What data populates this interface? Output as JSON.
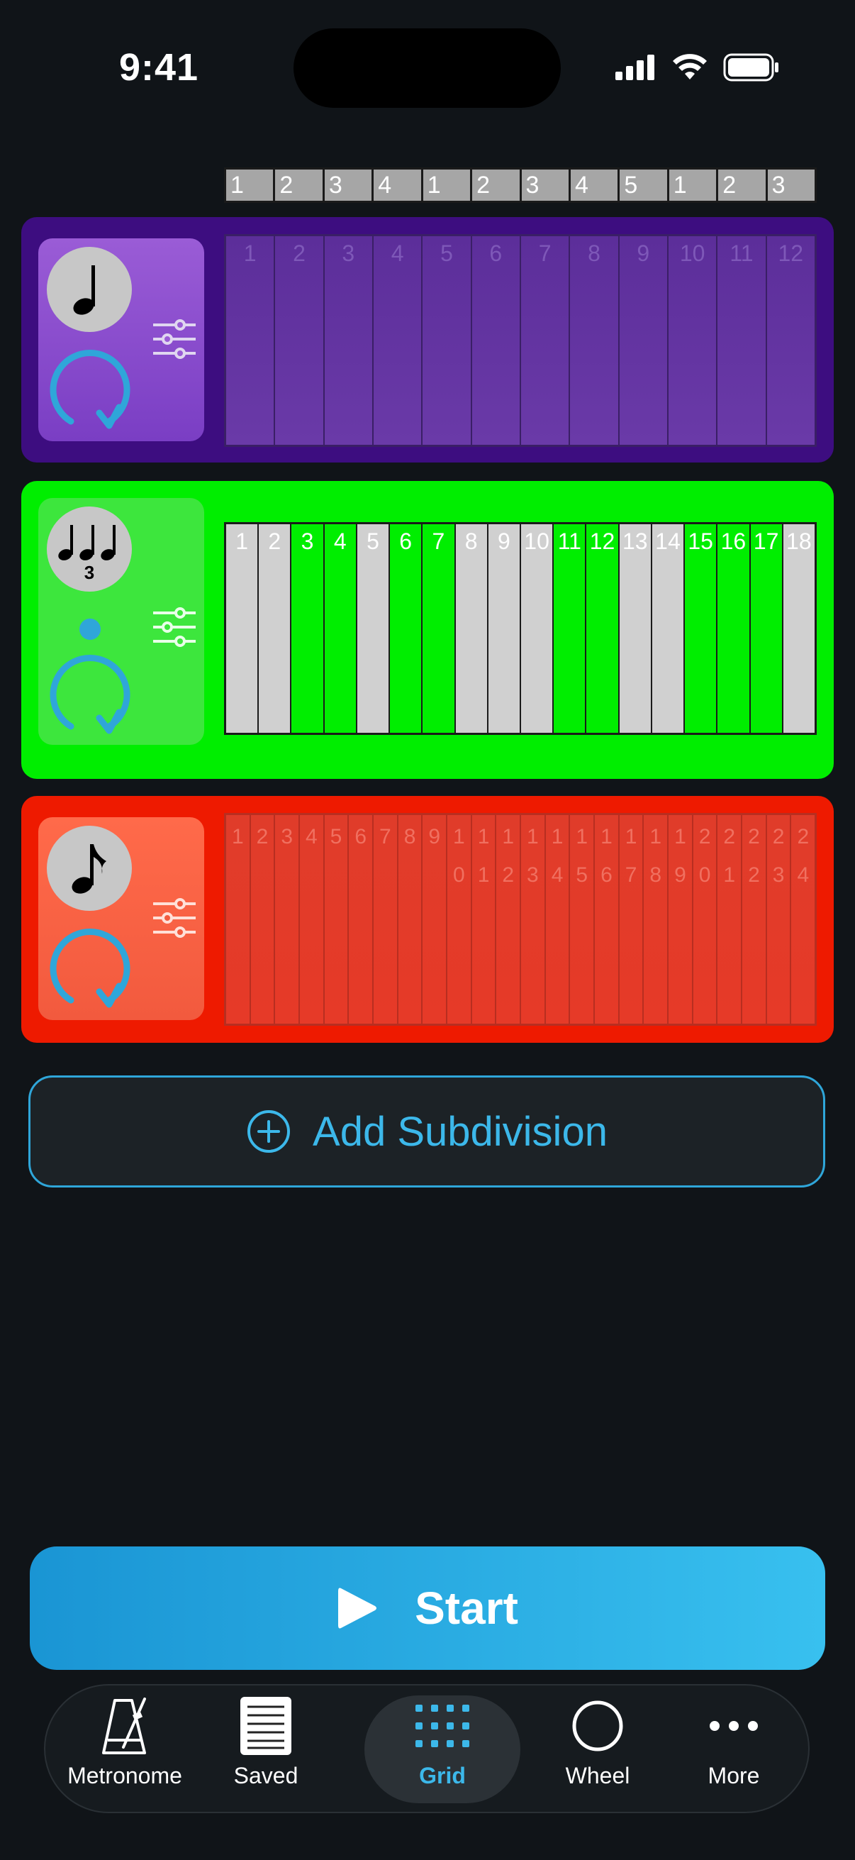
{
  "status_bar": {
    "time": "9:41"
  },
  "beat_header": [
    "1",
    "2",
    "3",
    "4",
    "1",
    "2",
    "3",
    "4",
    "5",
    "1",
    "2",
    "3"
  ],
  "rows": {
    "purple": {
      "note": "quarter",
      "cells": [
        "1",
        "2",
        "3",
        "4",
        "5",
        "6",
        "7",
        "8",
        "9",
        "10",
        "11",
        "12"
      ]
    },
    "green": {
      "note": "triplet",
      "triplet_label": "3",
      "cells": [
        {
          "label": "1",
          "on": true
        },
        {
          "label": "2",
          "on": true
        },
        {
          "label": "3",
          "on": false
        },
        {
          "label": "4",
          "on": false
        },
        {
          "label": "5",
          "on": true
        },
        {
          "label": "6",
          "on": false
        },
        {
          "label": "7",
          "on": false
        },
        {
          "label": "8",
          "on": true
        },
        {
          "label": "9",
          "on": true
        },
        {
          "label": "10",
          "on": true
        },
        {
          "label": "11",
          "on": false
        },
        {
          "label": "12",
          "on": false
        },
        {
          "label": "13",
          "on": true
        },
        {
          "label": "14",
          "on": true
        },
        {
          "label": "15",
          "on": false
        },
        {
          "label": "16",
          "on": false
        },
        {
          "label": "17",
          "on": false
        },
        {
          "label": "18",
          "on": true
        }
      ]
    },
    "red": {
      "note": "eighth",
      "cells": [
        "1",
        "2",
        "3",
        "4",
        "5",
        "6",
        "7",
        "8",
        "9",
        "10",
        "11",
        "12",
        "13",
        "14",
        "15",
        "16",
        "17",
        "18",
        "19",
        "20",
        "21",
        "22",
        "23",
        "24"
      ]
    }
  },
  "add_subdivision": {
    "label": "Add Subdivision"
  },
  "start": {
    "label": "Start"
  },
  "tabs": [
    {
      "label": "Metronome",
      "icon": "metronome-icon",
      "active": false
    },
    {
      "label": "Saved",
      "icon": "saved-list-icon",
      "active": false
    },
    {
      "label": "Grid",
      "icon": "grid-icon",
      "active": true
    },
    {
      "label": "Wheel",
      "icon": "wheel-icon",
      "active": false
    },
    {
      "label": "More",
      "icon": "more-icon",
      "active": false
    }
  ],
  "colors": {
    "accent": "#3cb8ea",
    "purple": "#3d0d80",
    "green": "#00ee00",
    "red": "#ee1a00",
    "background": "#101418"
  }
}
